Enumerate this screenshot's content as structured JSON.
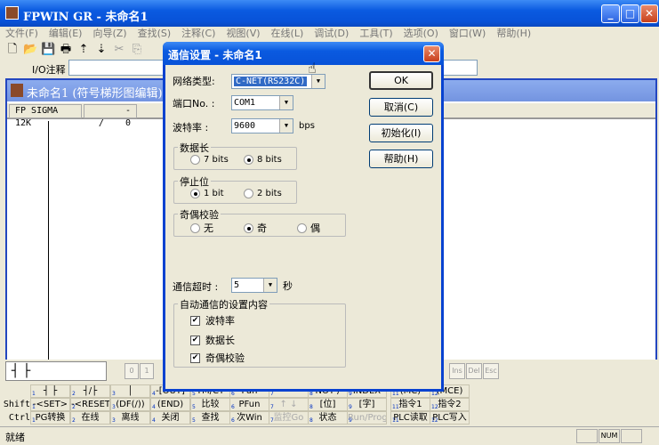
{
  "app": {
    "title": "FPWIN GR - 未命名1",
    "minimize": "_",
    "maximize": "□",
    "close": "✕"
  },
  "menu": [
    "文件(F)",
    "编辑(E)",
    "向导(Z)",
    "查找(S)",
    "注释(C)",
    "视图(V)",
    "在线(L)",
    "调试(D)",
    "工具(T)",
    "选项(O)",
    "窗口(W)",
    "帮助(H)"
  ],
  "toolbar": {
    "icons": [
      "new-file-icon",
      "open-folder-icon",
      "save-icon",
      "print-icon",
      "upload-icon",
      "download-icon",
      "cut-icon",
      "copy-icon"
    ],
    "glyphs": [
      "🗋",
      "📂",
      "💾",
      "🖶",
      "⇡",
      "⇣",
      "✂",
      "⎘"
    ]
  },
  "io_comment": {
    "label": "I/O注释",
    "value": ""
  },
  "child_window": {
    "title": "未命名1 (符号梯形图编辑)",
    "plc": "FP SIGMA 12K",
    "position": "- /",
    "count": "0"
  },
  "keypad": {
    "contact": "┤ ├",
    "keys": [
      "0",
      "1"
    ],
    "right_keys": [
      "Ins",
      "Del",
      "Esc"
    ]
  },
  "function_keys": {
    "row_labels": [
      "",
      "Shift",
      "Ctrl"
    ],
    "numbers": [
      "1",
      "2",
      "3",
      "4",
      "5",
      "6",
      "7",
      "8",
      "9",
      "11",
      "12"
    ],
    "rows": [
      [
        "┤ ├",
        "┤/├",
        "│",
        "-[OUT]",
        "TM/CT",
        "Fun",
        "",
        "NOT /",
        "INDEX",
        "(MC)",
        "(MCE)"
      ],
      [
        "-<SET>",
        "-<RESET>",
        "(DF(/))",
        "(END)",
        "比较",
        "PFun",
        "↑ ↓",
        "[位]",
        "[字]",
        "指令1",
        "指令2"
      ],
      [
        "PG转换",
        "在线",
        "离线",
        "关闭",
        "查找",
        "次Win",
        "监控Go",
        "状态",
        "Run/Prog",
        "PLC读取",
        "PLC写入"
      ]
    ],
    "disabled": [
      [],
      [
        6
      ],
      [
        6,
        8
      ]
    ]
  },
  "status": {
    "text": "就绪",
    "num": "NUM"
  },
  "dialog": {
    "title": "通信设置 - 未命名1",
    "network_label": "网络类型:",
    "network_value": "C-NET(RS232C)",
    "port_label": "端口No. :",
    "port_value": "COM1",
    "baud_label": "波特率  :",
    "baud_value": "9600",
    "baud_unit": "bps",
    "data_length": {
      "label": "数据长",
      "options": [
        "7 bits",
        "8 bits"
      ],
      "selected": 1
    },
    "stop_bit": {
      "label": "停止位",
      "options": [
        "1 bit",
        "2 bits"
      ],
      "selected": 0
    },
    "parity": {
      "label": "奇偶校验",
      "options": [
        "无",
        "奇",
        "偶"
      ],
      "selected": 1
    },
    "timeout_label": "通信超时 :",
    "timeout_value": "5",
    "timeout_unit": "秒",
    "auto": {
      "label": "自动通信的设置内容",
      "items": [
        "波特率",
        "数据长",
        "奇偶校验"
      ],
      "checked": [
        true,
        true,
        true
      ]
    },
    "buttons": {
      "ok": "OK",
      "cancel": "取消(C)",
      "init": "初始化(I)",
      "help": "帮助(H)"
    },
    "close": "✕"
  },
  "colors": {
    "title_blue": "#0a5ae0",
    "selection": "#316ac5",
    "inactive_title": "#7394e0"
  }
}
